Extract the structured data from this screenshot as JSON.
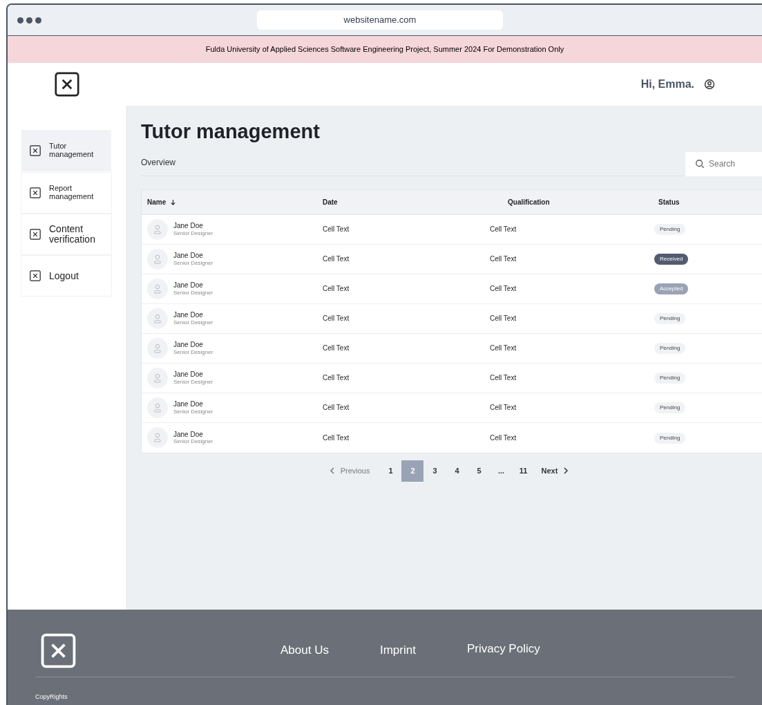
{
  "browser": {
    "url": "websitename.com"
  },
  "banner": "Fulda University of Applied Sciences Software Engineering Project, Summer 2024 For Demonstration Only",
  "header": {
    "greeting": "Hi, Emma."
  },
  "sidebar": {
    "items": [
      {
        "label": "Tutor management",
        "selected": true,
        "kind": "compact"
      },
      {
        "label": "Report management",
        "selected": false,
        "kind": "compact"
      },
      {
        "label": "Content verification",
        "selected": false,
        "kind": "regular"
      },
      {
        "label": "Logout",
        "selected": false,
        "kind": "regular"
      }
    ]
  },
  "page": {
    "title": "Tutor management",
    "section": "Overview",
    "search": {
      "placeholder": "Search"
    }
  },
  "table": {
    "columns": [
      "Name",
      "Date",
      "Qualification",
      "Status"
    ],
    "rows": [
      {
        "name": "Jane Doe",
        "role": "Senior Designer",
        "date": "Cell Text",
        "qualification": "Cell Text",
        "status": "Pending",
        "kind": "pending"
      },
      {
        "name": "Jane Doe",
        "role": "Senior Designer",
        "date": "Cell Text",
        "qualification": "Cell Text",
        "status": "Received",
        "kind": "received"
      },
      {
        "name": "Jane Doe",
        "role": "Senior Designer",
        "date": "Cell Text",
        "qualification": "Cell Text",
        "status": "Accepted",
        "kind": "accepted"
      },
      {
        "name": "Jane Doe",
        "role": "Senior Designer",
        "date": "Cell Text",
        "qualification": "Cell Text",
        "status": "Pending",
        "kind": "pending"
      },
      {
        "name": "Jane Doe",
        "role": "Senior Designer",
        "date": "Cell Text",
        "qualification": "Cell Text",
        "status": "Pending",
        "kind": "pending"
      },
      {
        "name": "Jane Doe",
        "role": "Senior Designer",
        "date": "Cell Text",
        "qualification": "Cell Text",
        "status": "Pending",
        "kind": "pending"
      },
      {
        "name": "Jane Doe",
        "role": "Senior Designer",
        "date": "Cell Text",
        "qualification": "Cell Text",
        "status": "Pending",
        "kind": "pending"
      },
      {
        "name": "Jane Doe",
        "role": "Senior Designer",
        "date": "Cell Text",
        "qualification": "Cell Text",
        "status": "Pending",
        "kind": "pending"
      }
    ]
  },
  "pagination": {
    "previous": "Previous",
    "next": "Next",
    "pages": [
      {
        "label": "1",
        "selected": false
      },
      {
        "label": "2",
        "selected": true
      },
      {
        "label": "3",
        "selected": false
      },
      {
        "label": "4",
        "selected": false
      },
      {
        "label": "5",
        "selected": false
      },
      {
        "label": "...",
        "selected": false
      },
      {
        "label": "11",
        "selected": false
      }
    ]
  },
  "footer": {
    "links": [
      "About Us",
      "Imprint",
      "Privacy Policy"
    ],
    "copyright": "CopyRights"
  }
}
